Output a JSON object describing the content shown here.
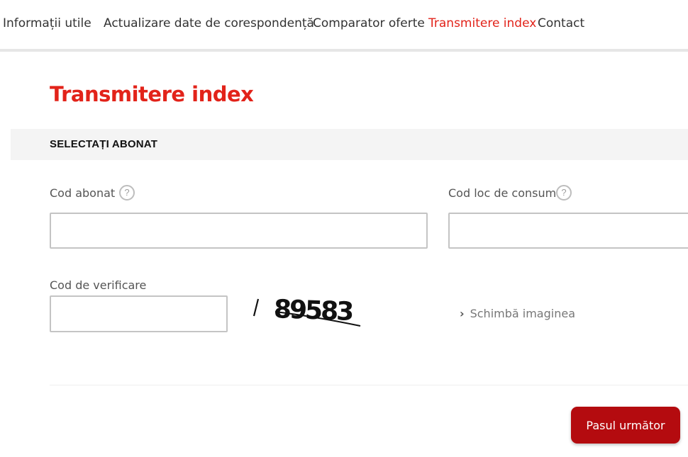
{
  "nav": {
    "items": [
      {
        "label": "Informații utile",
        "active": false
      },
      {
        "label": "Actualizare date de corespondență",
        "active": false
      },
      {
        "label": "Comparator oferte",
        "active": false
      },
      {
        "label": "Transmitere index",
        "active": true
      },
      {
        "label": "Contact",
        "active": false
      }
    ]
  },
  "page": {
    "title": "Transmitere index"
  },
  "section": {
    "title": "SELECTAȚI ABONAT"
  },
  "form": {
    "cod_abonat": {
      "label": "Cod abonat",
      "value": "",
      "help_icon": "question-icon"
    },
    "cod_loc_consum": {
      "label": "Cod loc de consum",
      "value": "",
      "help_icon": "question-icon"
    },
    "cod_verificare": {
      "label": "Cod de verificare",
      "value": ""
    },
    "captcha_text": "89583",
    "change_image_label": "Schimbă imaginea"
  },
  "actions": {
    "next_label": "Pasul următor"
  },
  "colors": {
    "accent": "#e2231a",
    "button": "#b40b0f"
  }
}
